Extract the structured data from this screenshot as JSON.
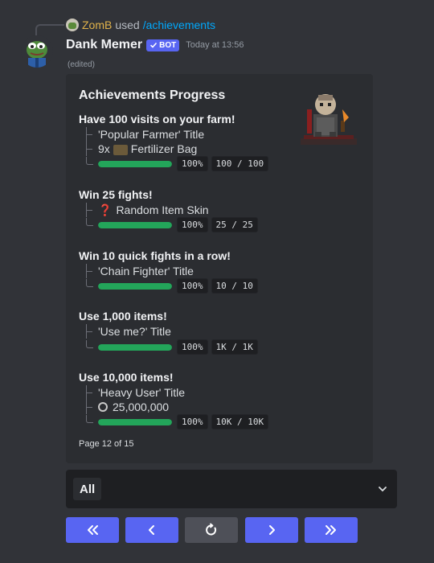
{
  "reply": {
    "user": "ZomB",
    "used": "used",
    "command": "/achievements"
  },
  "header": {
    "username": "Dank Memer",
    "bot_tag": "BOT",
    "timestamp": "Today at 13:56",
    "edited": "(edited)"
  },
  "embed": {
    "title": "Achievements Progress",
    "sections": [
      {
        "title": "Have 100 visits on your farm!",
        "rewards": [
          "'Popular Farmer' Title",
          "9x",
          "Fertilizer Bag"
        ],
        "percent": "100%",
        "count": "100 / 100",
        "progress": 1.0
      },
      {
        "title": "Win 25 fights!",
        "rewards": [
          "Random Item Skin"
        ],
        "percent": "100%",
        "count": "25 / 25",
        "progress": 1.0
      },
      {
        "title": "Win 10 quick fights in a row!",
        "rewards": [
          "'Chain Fighter' Title"
        ],
        "percent": "100%",
        "count": "10 / 10",
        "progress": 1.0
      },
      {
        "title": "Use 1,000 items!",
        "rewards": [
          "'Use me?' Title"
        ],
        "percent": "100%",
        "count": "1K / 1K",
        "progress": 1.0
      },
      {
        "title": "Use 10,000 items!",
        "rewards": [
          "'Heavy User' Title",
          "25,000,000"
        ],
        "percent": "100%",
        "count": "10K / 10K",
        "progress": 1.0
      }
    ],
    "footer": "Page 12 of 15"
  },
  "select": {
    "value": "All"
  },
  "buttons": [
    "first-page-icon",
    "previous-icon",
    "refresh-icon",
    "next-icon",
    "last-page-icon"
  ],
  "colors": {
    "blurple": "#5865f2",
    "progress_green": "#23a55a",
    "background": "#313338",
    "embed": "#2b2d31"
  }
}
